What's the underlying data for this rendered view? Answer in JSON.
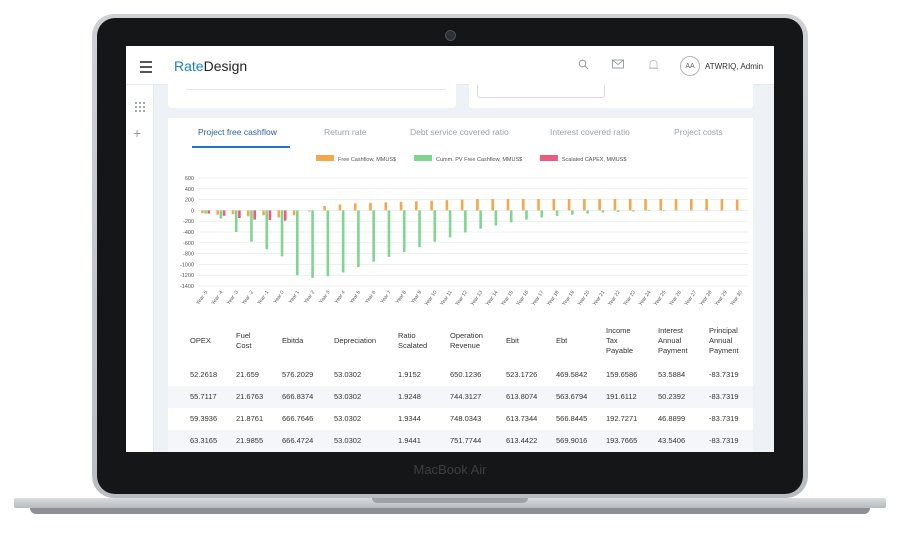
{
  "device": {
    "brand": "MacBook Air"
  },
  "app": {
    "logo_part1": "Rate",
    "logo_part2": "Design",
    "user": {
      "initials": "AA",
      "name": "ATWRIQ, Admin"
    },
    "icons": {
      "menu": "hamburger-menu-icon",
      "search": "search-icon",
      "mail": "mail-icon",
      "bell": "bell-icon",
      "grid": "grid-icon",
      "plus": "plus-icon"
    }
  },
  "tabs": [
    {
      "label": "Project free cashflow",
      "active": true
    },
    {
      "label": "Return rate",
      "active": false
    },
    {
      "label": "Debt service covered ratio",
      "active": false
    },
    {
      "label": "Interest covered ratio",
      "active": false
    },
    {
      "label": "Project costs",
      "active": false
    }
  ],
  "chart_data": {
    "type": "bar",
    "legend_position": "top",
    "grid": true,
    "ylim": [
      -1400,
      600
    ],
    "yticks": [
      600,
      400,
      200,
      0,
      -200,
      -400,
      -600,
      -800,
      -1000,
      -1200,
      -1400
    ],
    "categories": [
      "Year -5",
      "Year -4",
      "Year -3",
      "Year -2",
      "Year -1",
      "Year 0",
      "Year 1",
      "Year 2",
      "Year 3",
      "Year 4",
      "Year 5",
      "Year 6",
      "Year 7",
      "Year 8",
      "Year 9",
      "Year 10",
      "Year 11",
      "Year 12",
      "Year 13",
      "Year 14",
      "Year 15",
      "Year 16",
      "Year 17",
      "Year 18",
      "Year 19",
      "Year 20",
      "Year 21",
      "Year 22",
      "Year 23",
      "Year 24",
      "Year 25",
      "Year 26",
      "Year 27",
      "Year 28",
      "Year 29",
      "Year 30"
    ],
    "series": [
      {
        "name": "Free Cashflow, MMUS$",
        "color": "#f5a74a",
        "values": [
          -50,
          -80,
          -70,
          -110,
          -90,
          -130,
          -90,
          -20,
          80,
          110,
          130,
          140,
          150,
          160,
          170,
          180,
          190,
          200,
          210,
          210,
          210,
          210,
          210,
          210,
          210,
          210,
          210,
          210,
          210,
          210,
          210,
          210,
          210,
          210,
          210,
          200
        ]
      },
      {
        "name": "Cumm. PV Free Cashflow, MMUS$",
        "color": "#7ed68f",
        "values": [
          -60,
          -150,
          -400,
          -580,
          -720,
          -850,
          -1200,
          -1250,
          -1220,
          -1150,
          -1050,
          -950,
          -860,
          -770,
          -680,
          -580,
          -500,
          -410,
          -340,
          -280,
          -220,
          -170,
          -130,
          -100,
          -80,
          -60,
          -40,
          -30,
          -20,
          -10,
          -5,
          0,
          0,
          0,
          0,
          0
        ]
      },
      {
        "name": "Scalated CAPEX, MMUS$",
        "color": "#ec5a7d",
        "values": [
          -60,
          -100,
          -140,
          -170,
          -180,
          -190,
          0,
          0,
          0,
          0,
          0,
          0,
          0,
          0,
          0,
          0,
          0,
          0,
          0,
          0,
          0,
          0,
          0,
          0,
          0,
          0,
          0,
          0,
          0,
          0,
          0,
          0,
          0,
          0,
          0,
          0
        ]
      }
    ]
  },
  "table": {
    "headers": [
      "OPEX",
      "Fuel\nCost",
      "Ebitda",
      "Depreciation",
      "Ratio\nScalated",
      "Operation\nRevenue",
      "Ebit",
      "Ebt",
      "Income\nTax\nPayable",
      "Interest\nAnnual\nPayment",
      "Principal\nAnnual\nPayment"
    ],
    "rows": [
      [
        "52.2618",
        "21.659",
        "576.2029",
        "53.0302",
        "1.9152",
        "650.1236",
        "523.1726",
        "469.5842",
        "159.6586",
        "53.5884",
        "-83.7319"
      ],
      [
        "55.7117",
        "21.6763",
        "666.8374",
        "53.0302",
        "1.9248",
        "744.3127",
        "613.8074",
        "563.6794",
        "191.6112",
        "50.2392",
        "-83.7319"
      ],
      [
        "59.3936",
        "21.8761",
        "666.7646",
        "53.0302",
        "1.9344",
        "748.0343",
        "613.7344",
        "566.8445",
        "192.7271",
        "46.8899",
        "-83.7319"
      ],
      [
        "63.3165",
        "21.9855",
        "666.4724",
        "53.0302",
        "1.9441",
        "751.7744",
        "613.4422",
        "569.9016",
        "193.7665",
        "43.5406",
        "-83.7319"
      ]
    ]
  }
}
